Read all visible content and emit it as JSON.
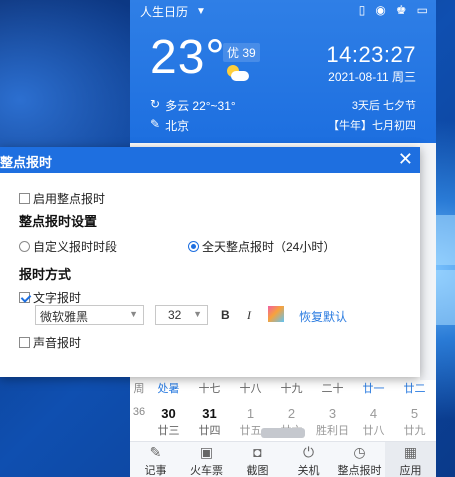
{
  "calendar": {
    "app_name": "人生日历",
    "temperature": "23°",
    "aqi": "优 39",
    "condition": "多云 22°~31°",
    "city": "北京",
    "time": "14:23:27",
    "date": "2021-08-11 周三",
    "festival": "3天后 七夕节",
    "lunar": "【牛年】七月初四",
    "week_header": "周",
    "week_labels": [
      "处暑",
      "十七",
      "十八",
      "十九",
      "二十",
      "廿一",
      "廿二"
    ],
    "week_number": "36",
    "days": [
      {
        "day": "30",
        "lunar": "廿三"
      },
      {
        "day": "31",
        "lunar": "廿四"
      },
      {
        "day": "1",
        "lunar": "廿五"
      },
      {
        "day": "2",
        "lunar": "廿六"
      },
      {
        "day": "3",
        "lunar": "胜利日"
      },
      {
        "day": "4",
        "lunar": "廿八"
      },
      {
        "day": "5",
        "lunar": "廿九"
      }
    ],
    "tools": [
      "记事",
      "火车票",
      "截图",
      "关机",
      "整点报时",
      "应用"
    ]
  },
  "dialog": {
    "title": "整点报时",
    "enable_label": "启用整点报时",
    "enable_checked": false,
    "settings_heading": "整点报时设置",
    "custom_period_label": "自定义报时时段",
    "all_day_label": "全天整点报时（24小时）",
    "mode_heading": "报时方式",
    "text_label": "文字报时",
    "text_checked": true,
    "font_value": "微软雅黑",
    "size_value": "32",
    "bold_label": "B",
    "italic_label": "I",
    "reset_label": "恢复默认",
    "sound_label": "声音报时",
    "sound_checked": false,
    "close_label": "✕"
  }
}
